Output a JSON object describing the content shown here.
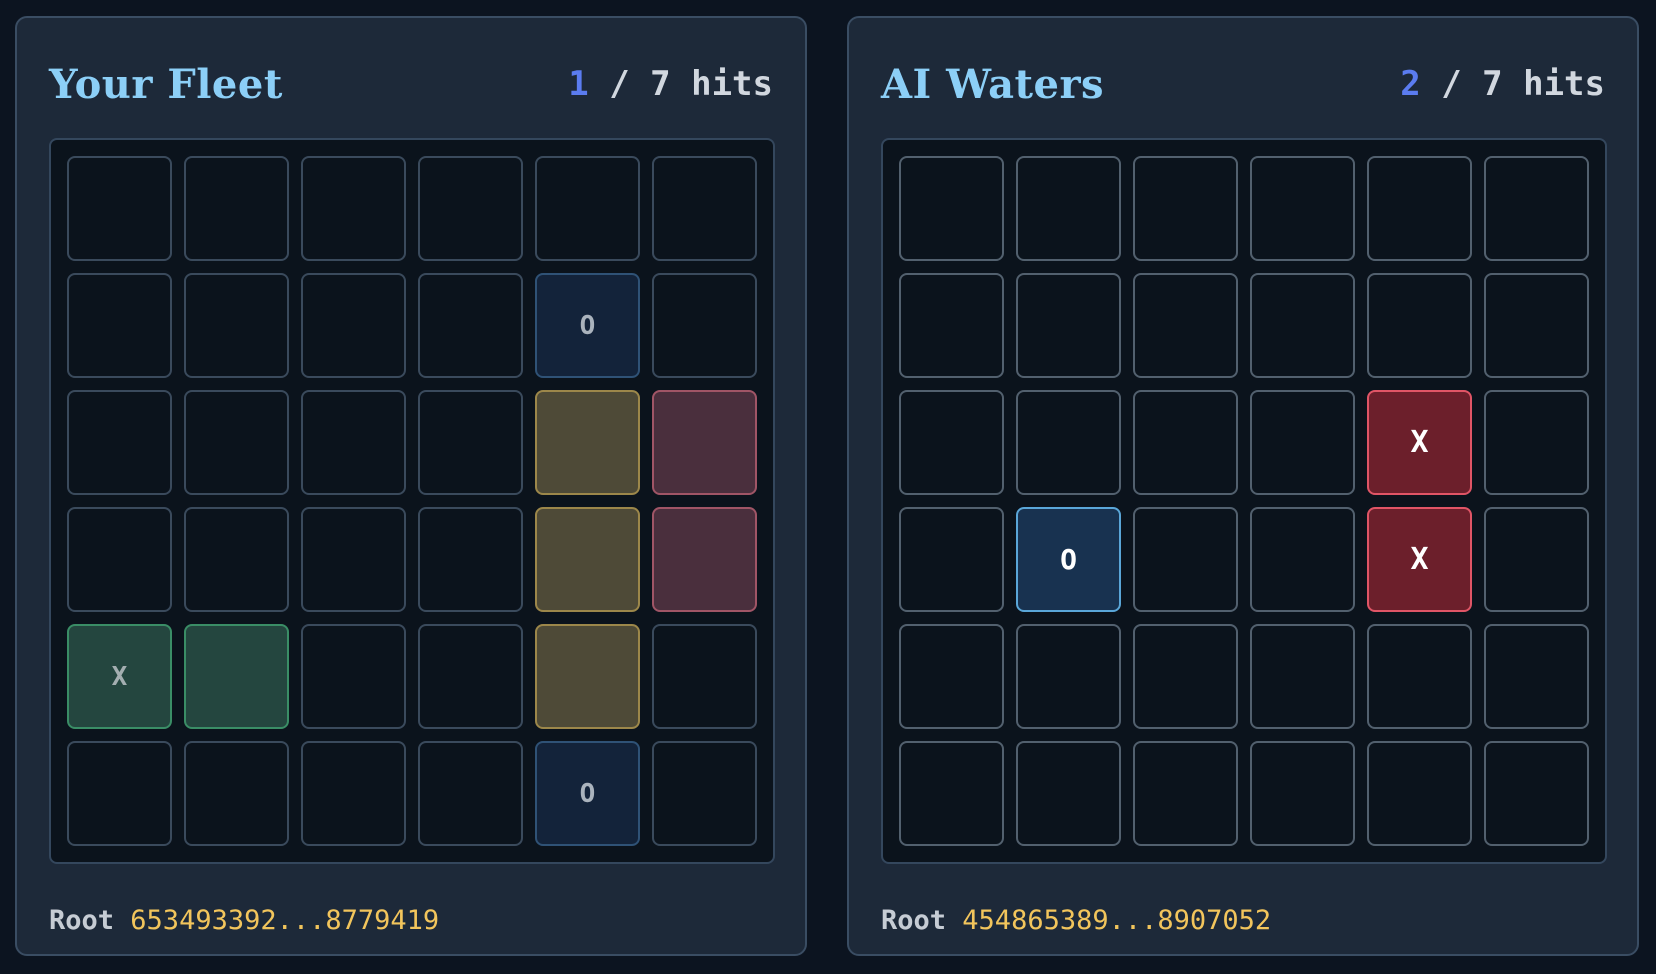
{
  "colors": {
    "background": "#0c1420",
    "panel": "#1d2939",
    "title": "#8ccff7",
    "hit_count": "#5b7cf0",
    "root_value": "#f2c55c",
    "hit_cell": "#6c1f2b",
    "miss_cell": "#183250"
  },
  "player": {
    "title": "Your Fleet",
    "hits": "1",
    "separator": " / ",
    "total": "7 hits",
    "root_label": "Root",
    "root_value": "653493392...8779419",
    "grid": [
      [
        "",
        "",
        "",
        "",
        "",
        ""
      ],
      [
        "",
        "",
        "",
        "",
        "O",
        ""
      ],
      [
        "",
        "",
        "",
        "",
        "",
        ""
      ],
      [
        "",
        "",
        "",
        "",
        "",
        ""
      ],
      [
        "X",
        "",
        "",
        "",
        "",
        ""
      ],
      [
        "",
        "",
        "",
        "",
        "O",
        ""
      ]
    ],
    "grid_state": [
      [
        "empty",
        "empty",
        "empty",
        "empty",
        "empty",
        "empty"
      ],
      [
        "empty",
        "empty",
        "empty",
        "empty",
        "miss",
        "empty"
      ],
      [
        "empty",
        "empty",
        "empty",
        "empty",
        "ship-gold",
        "ship-rose"
      ],
      [
        "empty",
        "empty",
        "empty",
        "empty",
        "ship-gold",
        "ship-rose"
      ],
      [
        "ship-green",
        "ship-green",
        "empty",
        "empty",
        "ship-gold",
        "empty"
      ],
      [
        "empty",
        "empty",
        "empty",
        "empty",
        "miss",
        "empty"
      ]
    ]
  },
  "ai": {
    "title": "AI Waters",
    "hits": "2",
    "separator": " / ",
    "total": "7 hits",
    "root_label": "Root",
    "root_value": "454865389...8907052",
    "grid": [
      [
        "",
        "",
        "",
        "",
        "",
        ""
      ],
      [
        "",
        "",
        "",
        "",
        "",
        ""
      ],
      [
        "",
        "",
        "",
        "",
        "X",
        ""
      ],
      [
        "",
        "O",
        "",
        "",
        "X",
        ""
      ],
      [
        "",
        "",
        "",
        "",
        "",
        ""
      ],
      [
        "",
        "",
        "",
        "",
        "",
        ""
      ]
    ],
    "grid_state": [
      [
        "empty",
        "empty",
        "empty",
        "empty",
        "empty",
        "empty"
      ],
      [
        "empty",
        "empty",
        "empty",
        "empty",
        "empty",
        "empty"
      ],
      [
        "empty",
        "empty",
        "empty",
        "empty",
        "hit-strong",
        "empty"
      ],
      [
        "empty",
        "miss-strong",
        "empty",
        "empty",
        "hit-strong",
        "empty"
      ],
      [
        "empty",
        "empty",
        "empty",
        "empty",
        "empty",
        "empty"
      ],
      [
        "empty",
        "empty",
        "empty",
        "empty",
        "empty",
        "empty"
      ]
    ]
  }
}
